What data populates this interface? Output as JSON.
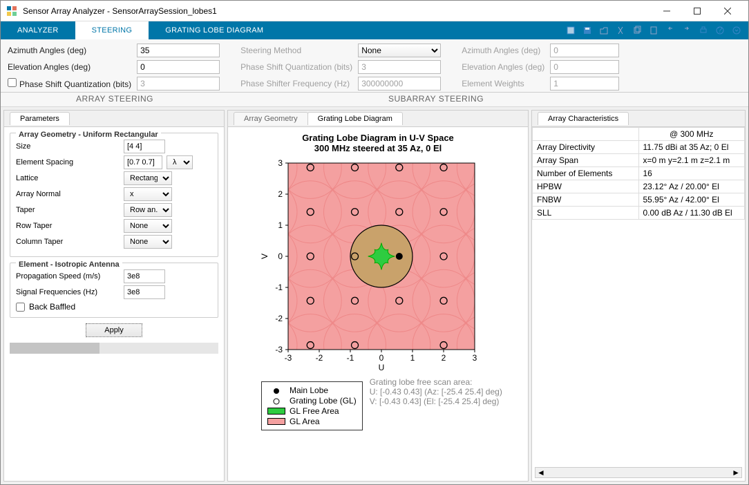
{
  "window": {
    "title": "Sensor Array Analyzer - SensorArraySession_lobes1"
  },
  "ribbon": {
    "tabs": [
      "ANALYZER",
      "STEERING",
      "GRATING LOBE DIAGRAM"
    ],
    "active": 1
  },
  "steering": {
    "left": {
      "azimuth_label": "Azimuth Angles (deg)",
      "azimuth_value": "35",
      "elevation_label": "Elevation Angles (deg)",
      "elevation_value": "0",
      "psq_label": "Phase Shift Quantization (bits)",
      "psq_value": "3",
      "section_label": "ARRAY STEERING"
    },
    "mid": {
      "method_label": "Steering Method",
      "method_value": "None",
      "psq_label": "Phase Shift Quantization (bits)",
      "psq_value": "3",
      "psf_label": "Phase Shifter Frequency (Hz)",
      "psf_value": "300000000"
    },
    "right": {
      "azimuth_label": "Azimuth Angles (deg)",
      "azimuth_value": "0",
      "elevation_label": "Elevation Angles (deg)",
      "elevation_value": "0",
      "weights_label": "Element Weights",
      "weights_value": "1",
      "section_label": "SUBARRAY STEERING"
    }
  },
  "parameters": {
    "tab": "Parameters",
    "group1_title": "Array Geometry - Uniform Rectangular",
    "size_label": "Size",
    "size_value": "[4 4]",
    "spacing_label": "Element Spacing",
    "spacing_value": "[0.7 0.7]",
    "spacing_unit": "λ",
    "lattice_label": "Lattice",
    "lattice_value": "Rectang...",
    "normal_label": "Array Normal",
    "normal_value": "x",
    "taper_label": "Taper",
    "taper_value": "Row an...",
    "rowtaper_label": "Row Taper",
    "rowtaper_value": "None",
    "coltaper_label": "Column Taper",
    "coltaper_value": "None",
    "group2_title": "Element - Isotropic Antenna",
    "prop_label": "Propagation Speed (m/s)",
    "prop_value": "3e8",
    "freq_label": "Signal Frequencies (Hz)",
    "freq_value": "3e8",
    "baffled_label": "Back Baffled",
    "apply_label": "Apply"
  },
  "center": {
    "tab_geometry": "Array Geometry",
    "tab_grating": "Grating Lobe Diagram",
    "chart_title": "Grating Lobe Diagram in U-V Space",
    "chart_sub": "300 MHz steered at 35 Az, 0 El",
    "x_label": "U",
    "y_label": "V",
    "legend_main": "Main Lobe",
    "legend_gl": "Grating Lobe (GL)",
    "legend_free": "GL Free Area",
    "legend_area": "GL Area",
    "scan_l1": "Grating lobe free scan area:",
    "scan_l2": "U: [-0.43 0.43] (Az: [-25.4 25.4] deg)",
    "scan_l3": "V: [-0.43 0.43] (El: [-25.4 25.4] deg)"
  },
  "characteristics": {
    "tab": "Array Characteristics",
    "col_header": "@ 300 MHz",
    "rows": [
      {
        "k": "Array Directivity",
        "v": "11.75 dBi at 35 Az; 0 El"
      },
      {
        "k": "Array Span",
        "v": "x=0 m y=2.1 m z=2.1 m"
      },
      {
        "k": "Number of Elements",
        "v": "16"
      },
      {
        "k": "HPBW",
        "v": "23.12° Az / 20.00° El"
      },
      {
        "k": "FNBW",
        "v": "55.95° Az / 42.00° El"
      },
      {
        "k": "SLL",
        "v": "0.00 dB Az / 11.30 dB El"
      }
    ]
  },
  "chart_data": {
    "type": "scatter",
    "title": "Grating Lobe Diagram in U-V Space — 300 MHz steered at 35 Az, 0 El",
    "xlabel": "U",
    "ylabel": "V",
    "xlim": [
      -3,
      3
    ],
    "ylim": [
      -3,
      3
    ],
    "main_lobe": {
      "u": 0.5736,
      "v": 0
    },
    "grating_lobe_spacing": 1.4286,
    "grating_lobes_u": [
      -2.2836,
      -0.855,
      2.0021,
      -2.2836,
      -0.855,
      0.5736,
      2.0021,
      -2.2836,
      -0.855,
      2.0021,
      -2.2836,
      -0.855,
      0.5736,
      2.0021,
      -2.2836,
      -0.855,
      0.5736,
      2.0021
    ],
    "grating_lobes_v": [
      -2.857,
      -2.857,
      -2.857,
      -1.4286,
      -1.4286,
      -1.4286,
      -1.4286,
      0,
      0,
      0,
      1.4286,
      1.4286,
      1.4286,
      1.4286,
      2.857,
      2.857,
      2.857,
      2.857
    ],
    "free_scan": {
      "u_min": -0.43,
      "u_max": 0.43,
      "v_min": -0.43,
      "v_max": 0.43,
      "az_deg": [
        -25.4,
        25.4
      ],
      "el_deg": [
        -25.4,
        25.4
      ]
    },
    "visible_region_radius": 1.0
  }
}
